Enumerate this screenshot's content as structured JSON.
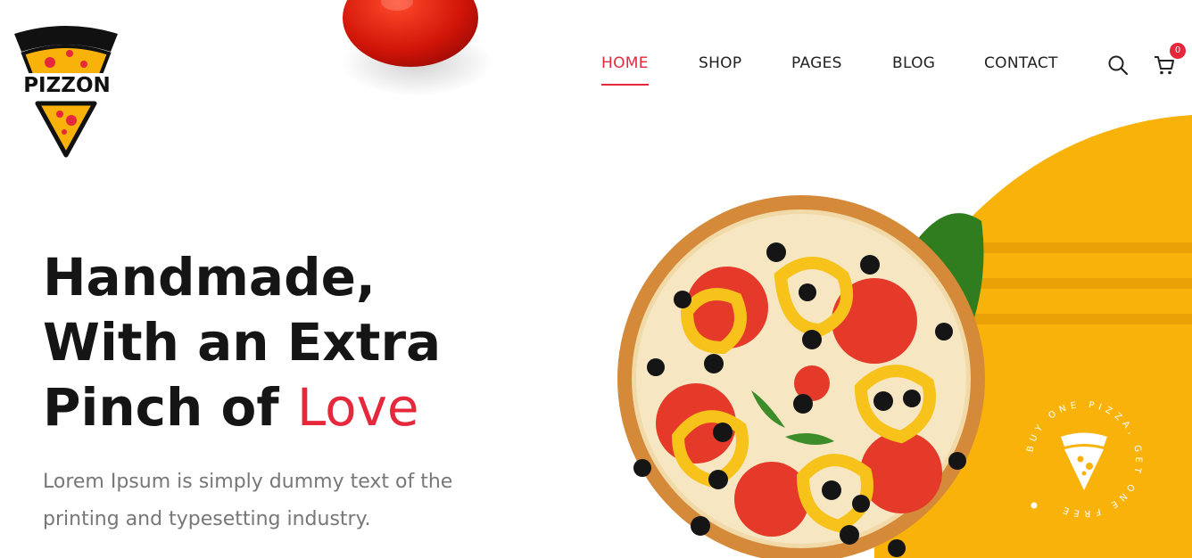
{
  "brand": {
    "name": "PIZZON",
    "accent": "#e5283c",
    "yellow": "#f8b20a"
  },
  "nav": {
    "items": [
      {
        "label": "HOME",
        "active": true
      },
      {
        "label": "SHOP",
        "active": false
      },
      {
        "label": "PAGES",
        "active": false
      },
      {
        "label": "BLOG",
        "active": false
      },
      {
        "label": "CONTACT",
        "active": false
      }
    ],
    "search_icon": "search-icon",
    "cart_icon": "cart-icon",
    "cart_count": "0"
  },
  "hero": {
    "title_line1": "Handmade,",
    "title_line2": "With an Extra",
    "title_line3_prefix": "Pinch of ",
    "title_highlight": "Love",
    "subtitle": "Lorem Ipsum is simply dummy text of the printing and typesetting industry."
  },
  "promo_badge": {
    "text": "BUY ONE PIZZA, GET ONE FREE"
  }
}
